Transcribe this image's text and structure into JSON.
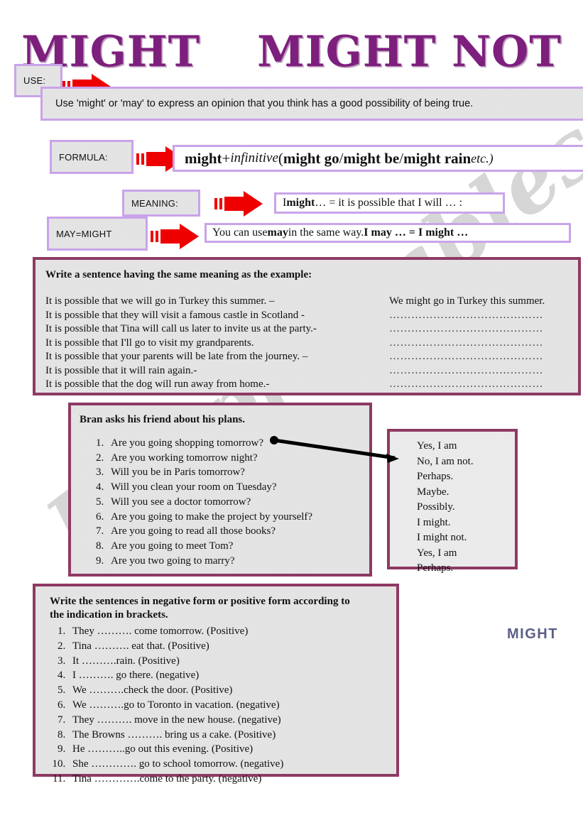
{
  "title": {
    "word1": "MIGHT",
    "word2": "MIGHT NOT"
  },
  "watermark": "ESLprintables.com",
  "labels": {
    "use": "USE:",
    "formula": "FORMULA:",
    "meaning": "MEANING:",
    "may_might": "MAY=MIGHT"
  },
  "statements": {
    "use_text": "Use 'might' or 'may' to express an opinion that you think has a good possibility of being true.",
    "formula_text": "might + infinitive (might go / might be / might rain etc.)",
    "formula_parts": {
      "p1": "might",
      "p2": " + ",
      "p3": "infinitive",
      "p4": " (",
      "p5": "might go",
      "p6": " / ",
      "p7": "might be",
      "p8": " / ",
      "p9": "might rain",
      "p10": " etc.)"
    },
    "meaning_text": "I might … =  it is possible that I will … :",
    "meaning_parts": {
      "p1": "I ",
      "p2": "might",
      "p3": " … =  it is possible that I will … :"
    },
    "may_might_text": "You can use may in the same way.  I may … = I might …",
    "may_might_parts": {
      "p1": "You can use ",
      "p2": "may",
      "p3": " in the same way.  ",
      "p4": "I may … = I might …"
    }
  },
  "exercise1": {
    "instruction": "Write a sentence having the same meaning as the example:",
    "prompts": [
      "It is possible that we will go in Turkey this summer. –",
      "It is possible that they will visit a famous castle in Scotland -",
      "It is possible that Tina will call us later to invite us at the party.-",
      "It is possible that I'll go to visit my grandparents.",
      "It is possible that your parents will be late from the journey. –",
      "It is possible that it will rain again.-",
      "It is possible that the dog will run away from home.-"
    ],
    "answers": [
      "We might go in Turkey this summer.",
      "……………………………………",
      "……………………………………",
      "……………………………………",
      "……………………………………",
      "……………………………………",
      "……………………………………"
    ]
  },
  "exercise2": {
    "instruction": "Bran asks his friend about his plans.",
    "questions": [
      "Are you going shopping tomorrow?",
      "Are you working tomorrow night?",
      "Will you be in Paris tomorrow?",
      "Will you clean your room on Tuesday?",
      "Will you see a doctor tomorrow?",
      "Are you going to make the project by yourself?",
      "Are you going to read all those books?",
      "Are you going to meet Tom?",
      "Are you two going to marry?"
    ],
    "answers": [
      "Yes, I am",
      "No, I am not.",
      "Perhaps.",
      "Maybe.",
      "Possibly.",
      "I might.",
      "I might not.",
      "Yes, I am",
      "Perhaps."
    ]
  },
  "exercise3": {
    "instruction_line1": "Write the sentences in negative form or positive form according to",
    "instruction_line2": "the indication in brackets.",
    "items": [
      "They ………. come tomorrow. (Positive)",
      "Tina ………. eat that. (Positive)",
      "It ……….rain. (Positive)",
      "I ………. go there. (negative)",
      "We ……….check the door. (Positive)",
      "We ……….go to Toronto in vacation. (negative)",
      "They ………. move in the new house. (negative)",
      "The Browns ………. bring us a cake. (Positive)",
      "He ………..go out this evening. (Positive)",
      "She …………. go to school tomorrow. (negative)",
      "Tina ………….come to the party. (negative)"
    ]
  },
  "footer": {
    "might_label": "MIGHT"
  },
  "colors": {
    "title_purple": "#7d1f7d",
    "chip_border_lavender": "#c9a3ea",
    "panel_border_maroon": "#8e3a63",
    "arrow_red": "#ee0000",
    "might_label_slate": "#5b5f86"
  }
}
